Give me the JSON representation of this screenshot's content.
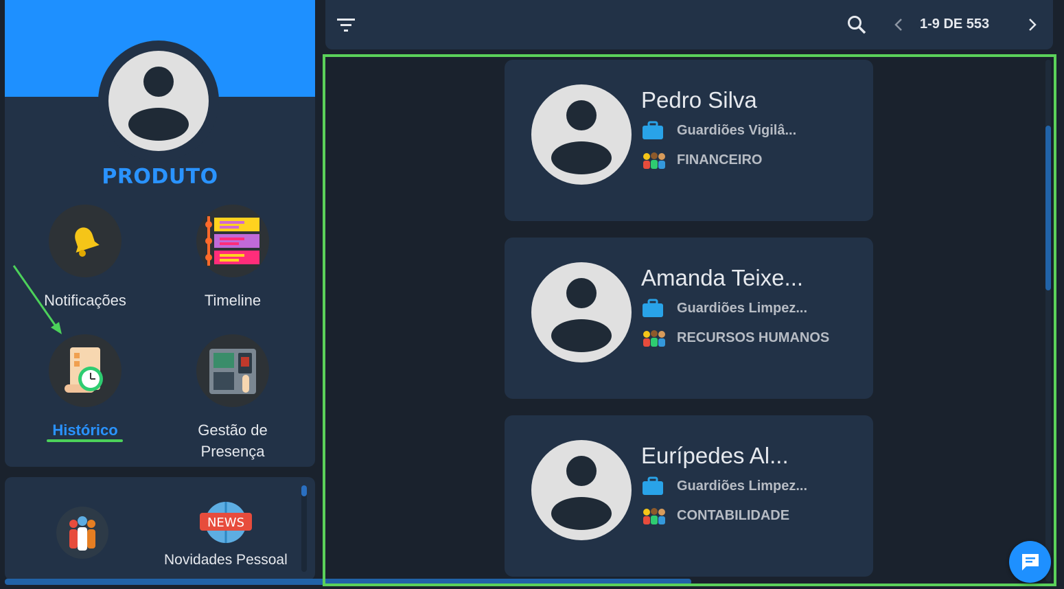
{
  "profile": {
    "name": "PRODUTO"
  },
  "menu": {
    "items": [
      {
        "label": "Notificações",
        "icon": "bell-icon"
      },
      {
        "label": "Timeline",
        "icon": "timeline-icon"
      },
      {
        "label": "Histórico",
        "icon": "history-icon",
        "active": true
      },
      {
        "label": "Gestão de Presença",
        "icon": "attendance-terminal-icon"
      }
    ],
    "extra_items": [
      {
        "label": "",
        "icon": "people-group-icon"
      },
      {
        "label": "Novidades Pessoal",
        "icon": "news-globe-icon",
        "badge": "NEWS"
      }
    ]
  },
  "toolbar": {
    "filter_icon": "filter-icon",
    "search_icon": "search-icon",
    "pagination": "1-9 DE 553",
    "prev_icon": "chevron-left-icon",
    "next_icon": "chevron-right-icon"
  },
  "people": [
    {
      "name": "Pedro Silva",
      "company": "Guardiões Vigilâ...",
      "department": "FINANCEIRO"
    },
    {
      "name": "Amanda Teixe...",
      "company": "Guardiões Limpez...",
      "department": "RECURSOS HUMANOS"
    },
    {
      "name": "Eurípedes Al...",
      "company": "Guardiões Limpez...",
      "department": "CONTABILIDADE"
    }
  ],
  "colors": {
    "accent": "#1e90ff",
    "highlight": "#5bd15a",
    "panel": "#223247",
    "background": "#1a222d"
  }
}
